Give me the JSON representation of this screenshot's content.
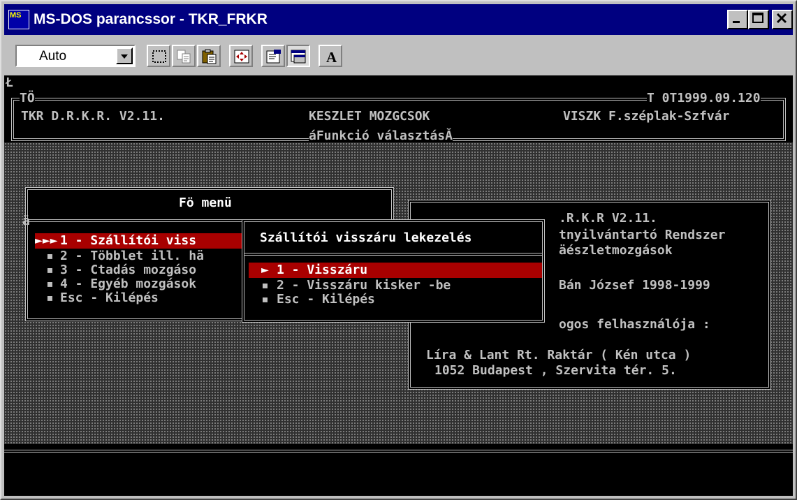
{
  "window": {
    "title": "MS-DOS parancssor - TKR_FRKR",
    "icon_text": "MS"
  },
  "toolbar": {
    "font_size": "Auto",
    "buttons": [
      "mark-icon",
      "copy-icon",
      "paste-icon",
      "fullscreen-icon",
      "properties-icon",
      "background-icon",
      "font-icon"
    ],
    "font_button_label": "A"
  },
  "console": {
    "corner_char": "Ł",
    "header": {
      "left_top": "TÖ",
      "right_top": "T 0T1999.09.120",
      "app": "TKR D.R.K.R. V2.11.",
      "module": "KESZLET MOZGCSOK",
      "site": "VISZK F.széplak-Szfvár",
      "subtitle": "áFunkció választásĂ"
    },
    "main_menu": {
      "title": "Fö menü",
      "left_mark": "ä",
      "items": [
        {
          "bullet": "►►►",
          "label": "1 - Szállítói viss"
        },
        {
          "bullet": "▪",
          "label": "2 - Többlet ill. hä"
        },
        {
          "bullet": "▪",
          "label": "3 - Ctadás mozgáso"
        },
        {
          "bullet": "▪",
          "label": "4 - Egyéb mozgások"
        },
        {
          "bullet": "▪",
          "label": "Esc - Kilépés"
        }
      ]
    },
    "info_panel": {
      "line1": ".R.K.R V2.11.",
      "line2": "tnyilvántartó Rendszer",
      "line3": "äészletmozgások",
      "line4": "Bán József 1998-1999",
      "line5": "ogos felhasználója :",
      "line6": "Líra & Lant Rt. Raktár ( Kén utca )",
      "line7": "1052 Budapest , Szervita tér. 5."
    },
    "submenu": {
      "title": "Szállítói visszáru lekezelés",
      "items": [
        {
          "bullet": "►",
          "label": "1 - Visszáru"
        },
        {
          "bullet": "▪",
          "label": "2 - Visszáru kisker -be"
        },
        {
          "bullet": "▪",
          "label": "Esc - Kilépés"
        }
      ]
    }
  },
  "colors": {
    "titlebar": "#000080",
    "selection": "#a80000",
    "console_text": "#c0c0c0"
  }
}
